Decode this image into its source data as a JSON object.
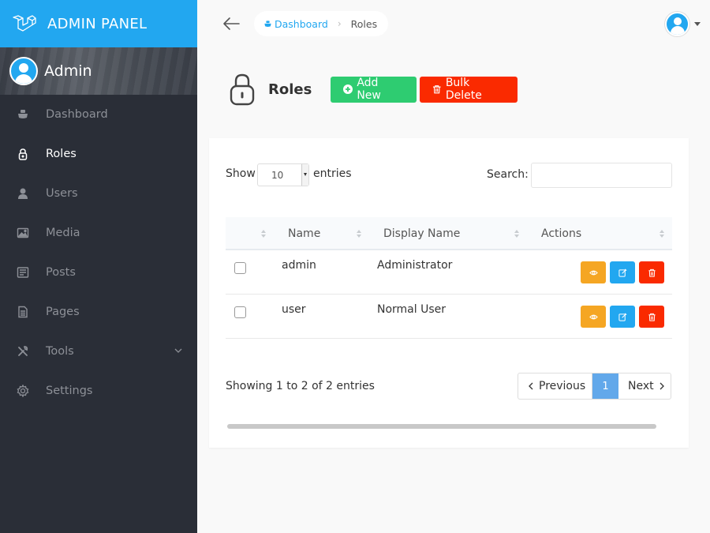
{
  "brand": {
    "title": "ADMIN PANEL",
    "color": "#22a7f0"
  },
  "profile": {
    "name": "Admin"
  },
  "sidebar": {
    "items": [
      {
        "label": "Dashboard",
        "icon": "boat-icon"
      },
      {
        "label": "Roles",
        "icon": "lock-icon",
        "active": true
      },
      {
        "label": "Users",
        "icon": "person-icon"
      },
      {
        "label": "Media",
        "icon": "image-icon"
      },
      {
        "label": "Posts",
        "icon": "news-icon"
      },
      {
        "label": "Pages",
        "icon": "file-text-icon"
      },
      {
        "label": "Tools",
        "icon": "tools-icon",
        "has_submenu": true
      },
      {
        "label": "Settings",
        "icon": "gear-icon"
      }
    ]
  },
  "breadcrumb": {
    "home": "Dashboard",
    "current": "Roles"
  },
  "page": {
    "title": "Roles",
    "add_label": "Add New",
    "bulk_delete_label": "Bulk Delete"
  },
  "table_controls": {
    "show_label": "Show",
    "length_value": "10",
    "entries_label": "entries",
    "search_label": "Search:",
    "search_value": ""
  },
  "table": {
    "columns": [
      "",
      "Name",
      "Display Name",
      "Actions"
    ],
    "rows": [
      {
        "name": "admin",
        "display_name": "Administrator"
      },
      {
        "name": "user",
        "display_name": "Normal User"
      }
    ]
  },
  "pagination": {
    "info": "Showing 1 to 2 of 2 entries",
    "previous": "Previous",
    "current_page": "1",
    "next": "Next"
  },
  "colors": {
    "success": "#2ecc71",
    "danger": "#fa2a00",
    "warning": "#f5a623",
    "primary": "#22a7f0",
    "sidebar_bg": "#2a2e37"
  }
}
